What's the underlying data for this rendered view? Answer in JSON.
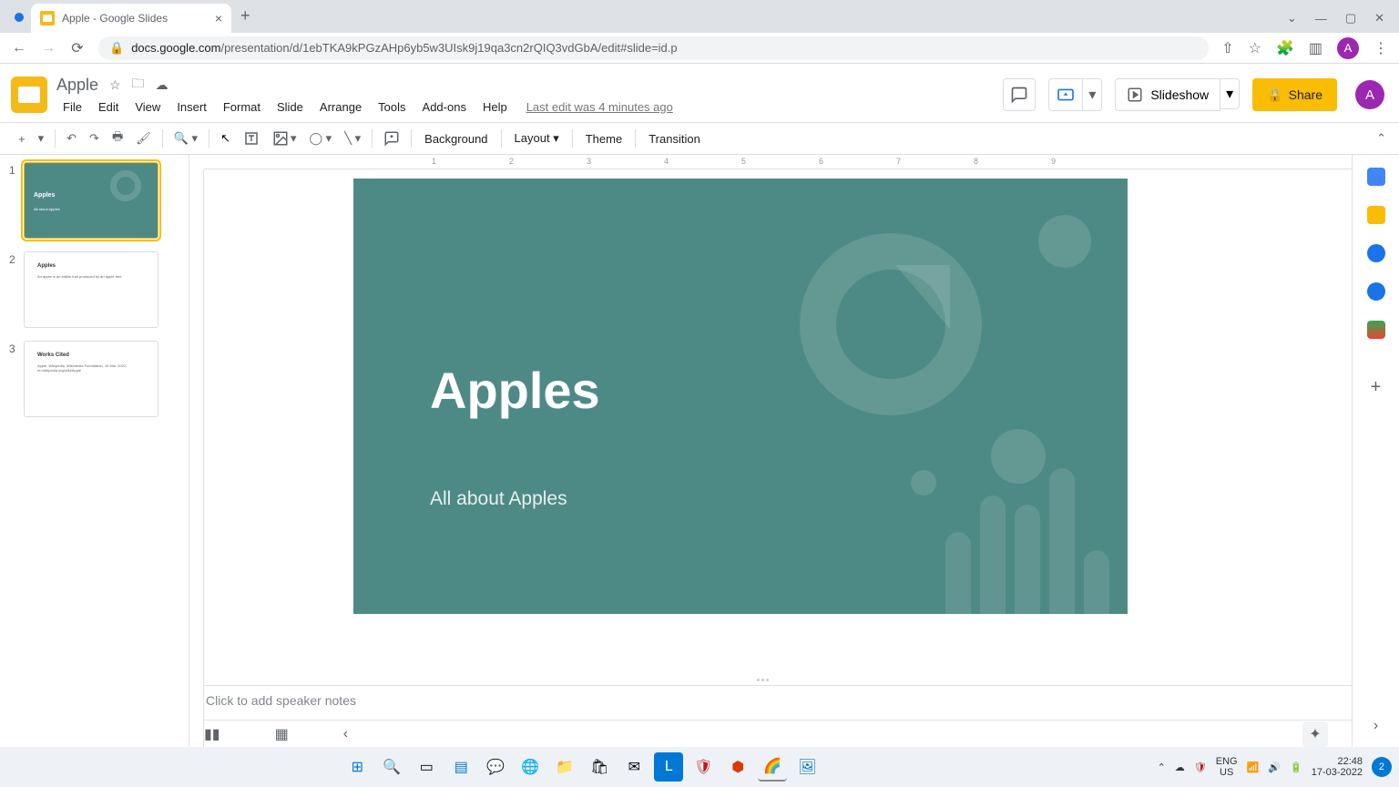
{
  "browser": {
    "tab_title": "Apple - Google Slides",
    "url_host": "docs.google.com",
    "url_path": "/presentation/d/1ebTKA9kPGzAHp6yb5w3UIsk9j19qa3cn2rQIQ3vdGbA/edit#slide=id.p",
    "avatar_letter": "A"
  },
  "doc": {
    "title": "Apple",
    "last_edit": "Last edit was 4 minutes ago"
  },
  "menu": {
    "file": "File",
    "edit": "Edit",
    "view": "View",
    "insert": "Insert",
    "format": "Format",
    "slide": "Slide",
    "arrange": "Arrange",
    "tools": "Tools",
    "addons": "Add-ons",
    "help": "Help"
  },
  "header_buttons": {
    "slideshow": "Slideshow",
    "share": "Share"
  },
  "toolbar": {
    "background": "Background",
    "layout": "Layout",
    "theme": "Theme",
    "transition": "Transition"
  },
  "filmstrip": {
    "slides": [
      {
        "num": "1",
        "title": "Apples",
        "sub": "All about Apples"
      },
      {
        "num": "2",
        "title": "Apples",
        "body": "An apple is an edible fruit produced by an apple tree."
      },
      {
        "num": "3",
        "title": "Works Cited",
        "body": "Apple, Wikipedia, Wikimedia Foundation, 15 Mar. 2022, en.wikipedia.org/wiki/Apple"
      }
    ]
  },
  "slide": {
    "title": "Apples",
    "subtitle": "All about Apples",
    "bg_color": "#4e8a85"
  },
  "speaker_notes_placeholder": "Click to add speaker notes",
  "ruler": {
    "marks": [
      "1",
      "2",
      "3",
      "4",
      "5",
      "6",
      "7",
      "8",
      "9"
    ]
  },
  "taskbar": {
    "lang1": "ENG",
    "lang2": "US",
    "time": "22:48",
    "date": "17-03-2022",
    "noti_count": "2"
  }
}
